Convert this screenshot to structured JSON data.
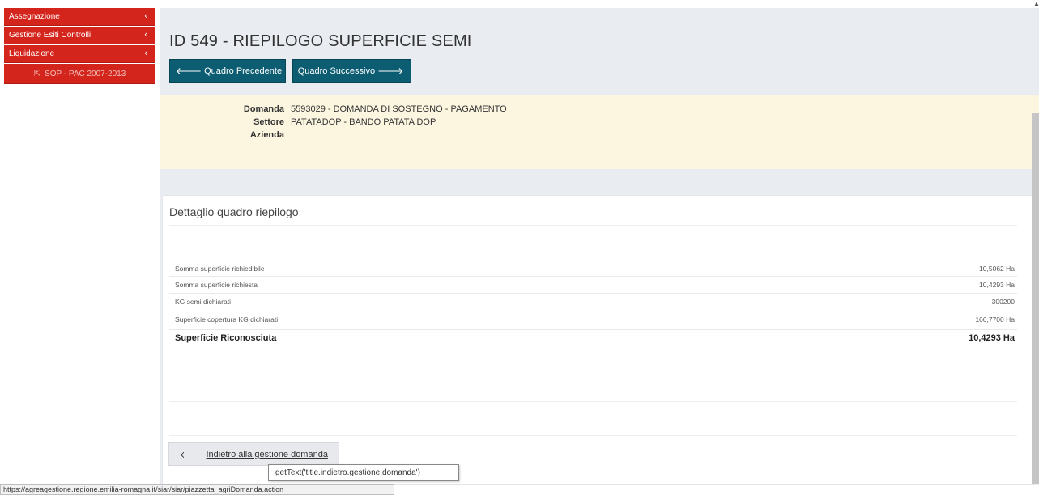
{
  "sidebar": {
    "items": [
      {
        "label": "Assegnazione",
        "chevron": "‹"
      },
      {
        "label": "Gestione Esiti Controlli",
        "chevron": "‹"
      },
      {
        "label": "Liquidazione",
        "chevron": "‹"
      }
    ],
    "sub_item": {
      "label": "SOP - PAC 2007-2013",
      "icon": "external-link-icon"
    }
  },
  "page": {
    "title": "ID 549 - RIEPILOGO SUPERFICIE SEMI",
    "prev_button": "Quadro Precedente",
    "next_button": "Quadro Successivo",
    "accent_color": "#0c5d72",
    "sidebar_color": "#d4251c"
  },
  "info": {
    "domanda_label": "Domanda",
    "domanda_value": "5593029 - DOMANDA DI SOSTEGNO - PAGAMENTO",
    "settore_label": "Settore",
    "settore_value": "PATATADOP - BANDO PATATA DOP",
    "azienda_label": "Azienda",
    "azienda_value": ""
  },
  "panel": {
    "title": "Dettaglio quadro riepilogo",
    "rows": [
      {
        "label": "Somma superficie richiedibile",
        "value": "10,5062 Ha"
      },
      {
        "label": "Somma superficie richiesta",
        "value": "10,4293 Ha"
      },
      {
        "label": "KG semi dichiarati",
        "value": "300200"
      },
      {
        "label": "Superficie copertura KG dichiarati",
        "value": "166,7700 Ha"
      }
    ],
    "total": {
      "label": "Superficie Riconosciuta",
      "value": "10,4293 Ha"
    },
    "back_button": "Indietro alla gestione domanda"
  },
  "tooltip": "getText('title.indietro.gestione.domanda')",
  "statusbar": "https://agreagestione.regione.emilia-romagna.it/siar/siar/piazzetta_agriDomanda.action"
}
